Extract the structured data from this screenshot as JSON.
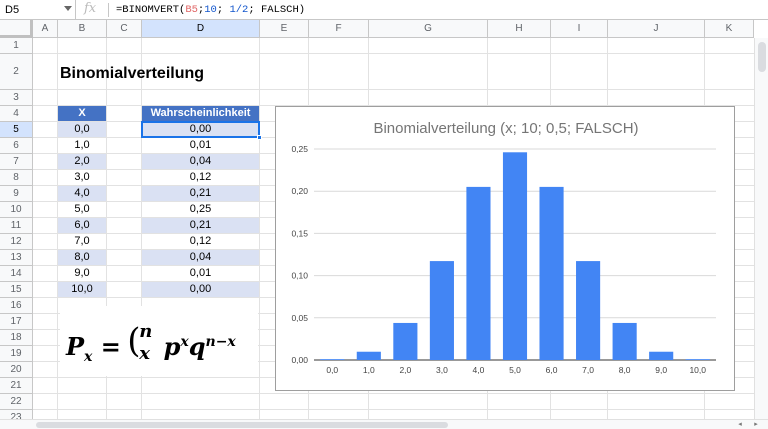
{
  "formula_bar": {
    "name_box": "D5",
    "fx_icon": "fx-icon",
    "formula_prefix": "=BINOMVERT(",
    "formula_ref": "B5",
    "formula_mid1": ";",
    "formula_n": "10",
    "formula_mid2": "; ",
    "formula_p": "1/2",
    "formula_suffix": "; FALSCH)"
  },
  "grid": {
    "columns": [
      "A",
      "B",
      "C",
      "D",
      "E",
      "F",
      "G",
      "H",
      "I",
      "J",
      "K"
    ],
    "rows": [
      "1",
      "2",
      "3",
      "4",
      "5",
      "6",
      "7",
      "8",
      "9",
      "10",
      "11",
      "12",
      "13",
      "14",
      "15",
      "16",
      "17",
      "18",
      "19",
      "20",
      "21",
      "22",
      "23"
    ],
    "selected_column": "D",
    "selected_row": "5"
  },
  "sheet": {
    "title": "Binomialverteilung",
    "x_header": "X",
    "p_header": "Wahrscheinlichkeit",
    "x_values": [
      "0,0",
      "1,0",
      "2,0",
      "3,0",
      "4,0",
      "5,0",
      "6,0",
      "7,0",
      "8,0",
      "9,0",
      "10,0"
    ],
    "p_values": [
      "0,00",
      "0,01",
      "0,04",
      "0,12",
      "0,21",
      "0,25",
      "0,21",
      "0,12",
      "0,04",
      "0,01",
      "0,00"
    ]
  },
  "formula_image": {
    "lhs": "P",
    "lhs_sub": "x",
    "eq": "=",
    "binom_top": "n",
    "binom_bottom": "x",
    "p": "p",
    "p_sup": "x",
    "q": "q",
    "q_sup": "n−x"
  },
  "colors": {
    "bar": "#4285f4",
    "header_fill": "#4472c4",
    "band_fill": "#dae1f3",
    "selection": "#1a73e8"
  },
  "chart_data": {
    "type": "bar",
    "title": "Binomialverteilung (x; 10; 0,5; FALSCH)",
    "categories": [
      "0,0",
      "1,0",
      "2,0",
      "3,0",
      "4,0",
      "5,0",
      "6,0",
      "7,0",
      "8,0",
      "9,0",
      "10,0"
    ],
    "values": [
      0.001,
      0.0098,
      0.0439,
      0.1172,
      0.2051,
      0.2461,
      0.2051,
      0.1172,
      0.0439,
      0.0098,
      0.001
    ],
    "ylim": [
      0,
      0.25
    ],
    "yticks": [
      "0,00",
      "0,05",
      "0,10",
      "0,15",
      "0,20",
      "0,25"
    ],
    "grid": true,
    "legend": "none"
  }
}
